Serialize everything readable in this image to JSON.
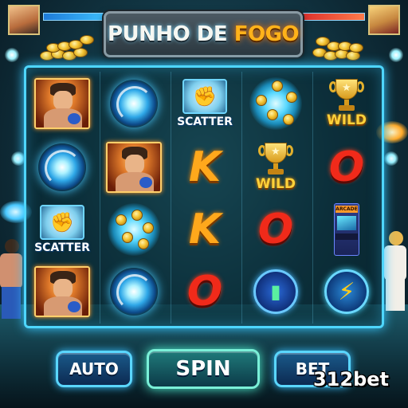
{
  "title": {
    "part1": "PUNHO DE ",
    "part2": "FOGO",
    "accent_color": "#ffb21a"
  },
  "hud": {
    "player_left_icon": "fighter-portrait-icon",
    "player_right_icon": "fighter-portrait-icon",
    "health_left_color": "#40c5ff",
    "health_right_color": "#ff4a3a"
  },
  "reels": {
    "columns": [
      [
        "fighter",
        "vortex",
        "scatter",
        "fighter"
      ],
      [
        "vortex",
        "fighter",
        "coin-burst",
        "vortex"
      ],
      [
        "scatter",
        "K",
        "K",
        "O"
      ],
      [
        "coin-burst",
        "wild",
        "O",
        "battery"
      ],
      [
        "wild",
        "O",
        "arcade",
        "bolt"
      ]
    ],
    "labels": {
      "scatter": "SCATTER",
      "wild": "WILD",
      "k": "K",
      "o": "O",
      "arcade": "ARCADE"
    }
  },
  "controls": {
    "auto_label": "AUTO",
    "spin_label": "SPIN",
    "bet_label": "BET"
  },
  "brand": {
    "watermark": "312bet"
  },
  "colors": {
    "frame_glow": "#4ed6ff",
    "k_color": "#ffa81c",
    "o_color": "#f02a1a",
    "wild_color": "#ffd23a"
  }
}
